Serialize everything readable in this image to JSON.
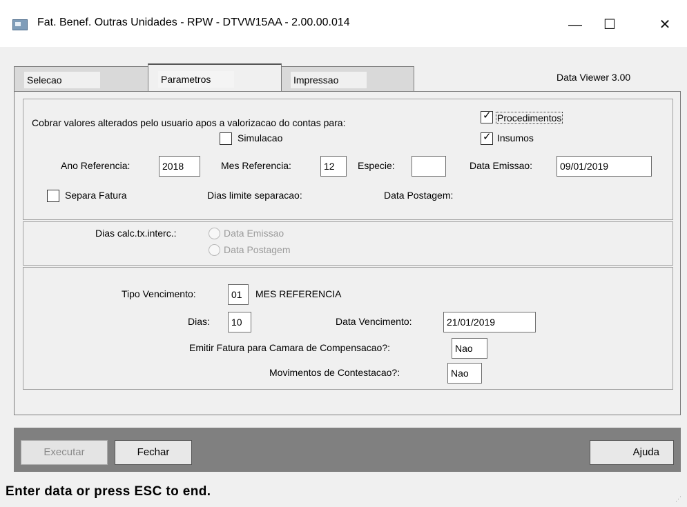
{
  "window": {
    "title": "Fat. Benef. Outras Unidades - RPW - DTVW15AA - 2.00.00.014",
    "minimize_glyph": "—",
    "maximize_glyph": "☐",
    "close_glyph": "✕"
  },
  "tabs": [
    {
      "label": "Selecao",
      "active": false
    },
    {
      "label": "Parametros",
      "active": true
    },
    {
      "label": "Impressao",
      "active": false
    }
  ],
  "viewer_version": "Data Viewer 3.00",
  "params": {
    "cobrar_label": "Cobrar valores alterados pelo usuario apos a valorizacao do contas para:",
    "procedimentos": {
      "label": "Procedimentos",
      "checked": true
    },
    "insumos": {
      "label": "Insumos",
      "checked": true
    },
    "simulacao": {
      "label": "Simulacao",
      "checked": false
    },
    "ano_referencia": {
      "label": "Ano Referencia:",
      "value": "2018"
    },
    "mes_referencia": {
      "label": "Mes Referencia:",
      "value": "12"
    },
    "especie": {
      "label": "Especie:",
      "value": ""
    },
    "data_emissao": {
      "label": "Data Emissao:",
      "value": "09/01/2019"
    },
    "separa_fatura": {
      "label": "Separa Fatura",
      "checked": false
    },
    "dias_limite_label": "Dias limite separacao:",
    "data_postagem_label": "Data Postagem:"
  },
  "calc": {
    "label": "Dias calc.tx.interc.:",
    "options": [
      "Data Emissao",
      "Data Postagem"
    ]
  },
  "venc": {
    "tipo": {
      "label": "Tipo Vencimento:",
      "value": "01",
      "desc": "MES REFERENCIA"
    },
    "dias": {
      "label": "Dias:",
      "value": "10"
    },
    "data_vencimento": {
      "label": "Data Vencimento:",
      "value": "21/01/2019"
    },
    "camara": {
      "label": "Emitir Fatura para Camara de Compensacao?:",
      "value": "Nao"
    },
    "contestacao": {
      "label": "Movimentos de Contestacao?:",
      "value": "Nao"
    }
  },
  "buttons": {
    "executar": "Executar",
    "fechar": "Fechar",
    "ajuda": "Ajuda"
  },
  "status_text": "Enter data or press ESC to end.",
  "check_glyph": "✓",
  "resize_glyph": "⋰"
}
